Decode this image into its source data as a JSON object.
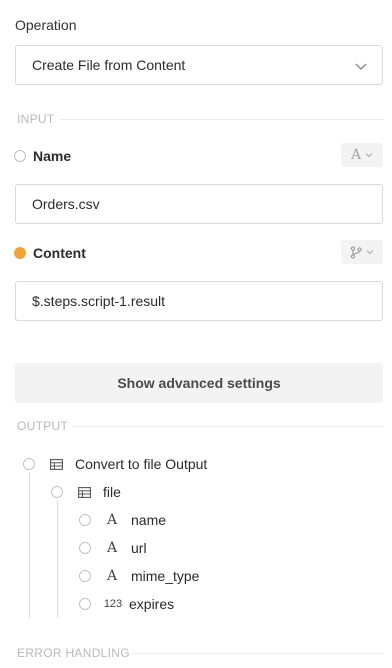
{
  "operation": {
    "label": "Operation",
    "selected": "Create File from Content",
    "chevron_icon": "chevron-down-icon"
  },
  "input": {
    "section_title": "INPUT",
    "name_field": {
      "label": "Name",
      "value": "Orders.csv",
      "type_icon": "text-type-icon",
      "required_indicator": "empty"
    },
    "content_field": {
      "label": "Content",
      "value": "$.steps.script-1.result",
      "type_icon": "branch-icon",
      "required_indicator": "filled",
      "indicator_color": "#f2a33a"
    }
  },
  "advanced_button": "Show advanced settings",
  "output": {
    "section_title": "OUTPUT",
    "root": {
      "label": "Convert to file Output",
      "icon": "table-icon"
    },
    "child": {
      "label": "file",
      "icon": "table-icon"
    },
    "fields": [
      {
        "label": "name",
        "type": "A"
      },
      {
        "label": "url",
        "type": "A"
      },
      {
        "label": "mime_type",
        "type": "A"
      },
      {
        "label": "expires",
        "type": "123"
      }
    ]
  },
  "error_handling": {
    "section_title": "ERROR HANDLING"
  }
}
